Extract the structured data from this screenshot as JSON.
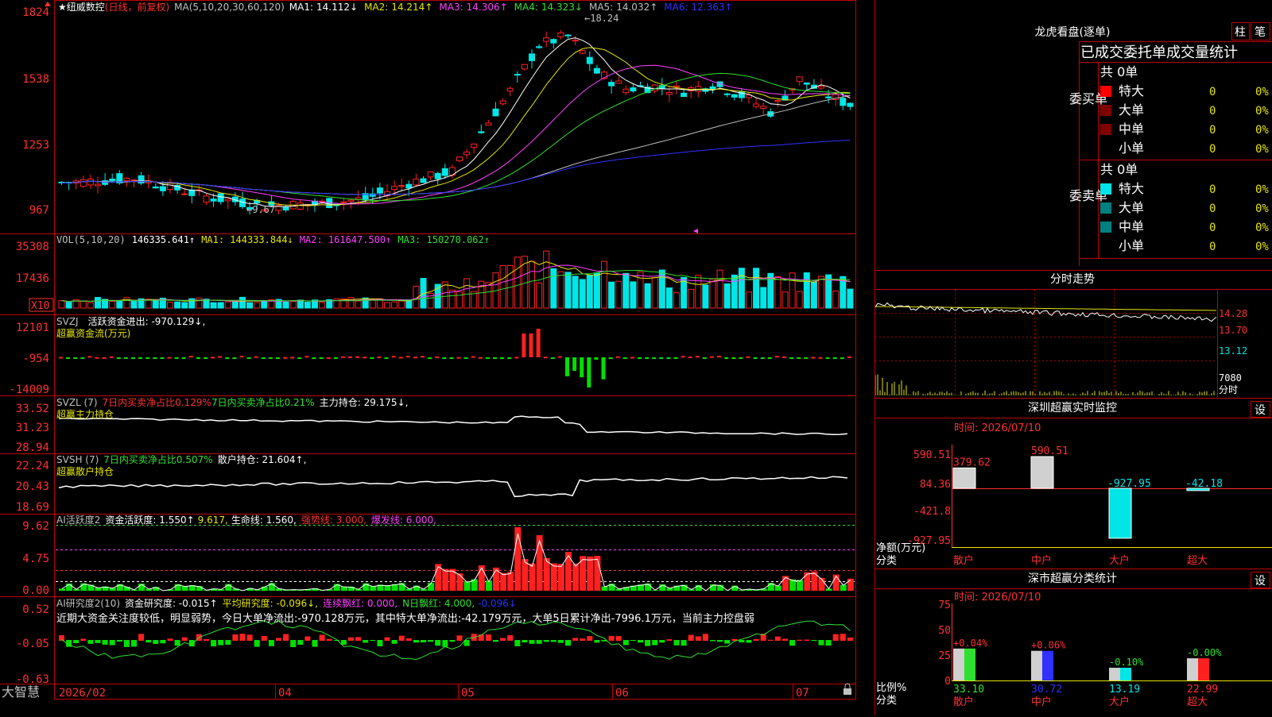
{
  "app": {
    "name": "大智慧"
  },
  "colors": {
    "up": "#ff2020",
    "down": "#00e6e6",
    "grid": "#a00000",
    "axis": "#ff3030",
    "ma1": "#ffffff",
    "ma2": "#e6e600",
    "ma3": "#ff40ff",
    "ma4": "#30e030",
    "ma5": "#c0c0c0",
    "ma6": "#3030ff"
  },
  "price_panel": {
    "star": "★",
    "stock_name": "纽威数控",
    "period": "(日线，前复权)",
    "ma_params": "MA(5,10,20,30,60,120)",
    "ma": [
      {
        "label": "MA1:",
        "value": "14.112↓",
        "color": "#ffffff"
      },
      {
        "label": "MA2:",
        "value": "14.214↑",
        "color": "#e6e600"
      },
      {
        "label": "MA3:",
        "value": "14.306↑",
        "color": "#ff40ff"
      },
      {
        "label": "MA4:",
        "value": "14.323↓",
        "color": "#30e030"
      },
      {
        "label": "MA5:",
        "value": "14.032↑",
        "color": "#c0c0c0"
      },
      {
        "label": "MA6:",
        "value": "12.363↑",
        "color": "#3030ff"
      }
    ],
    "axis": [
      "1824",
      "1538",
      "1253",
      "967"
    ],
    "high_note": "18.24",
    "low_note": "9.67"
  },
  "vol_panel": {
    "label": "VOL(5,10,20)",
    "value": "146335.641↑",
    "ma1": "MA1: 144333.844↓",
    "ma2": "MA2: 161647.500↑",
    "ma3": "MA3: 150270.062↑",
    "axis": [
      "35308",
      "17436"
    ],
    "unit": "X10"
  },
  "svzj_panel": {
    "label": "SVZJ",
    "desc": "活跃资金进出: -970.129↓,",
    "sub": "超赢资金流(万元)",
    "axis": [
      "12101",
      "-954",
      "-14009"
    ]
  },
  "svzl_panel": {
    "label": "SVZL (7)",
    "a": "7日内买卖净占比0.129%",
    "b": "7日内买卖净占比0.21%",
    "c": "主力持仓: 29.175↓,",
    "sub": "超赢主力持仓",
    "axis": [
      "33.52",
      "31.23",
      "28.94"
    ]
  },
  "svsh_panel": {
    "label": "SVSH (7)",
    "a": "7日内买卖净占比0.507%",
    "c": "散户持仓: 21.604↑,",
    "sub": "超赢散户持仓",
    "axis": [
      "22.24",
      "20.43",
      "18.69"
    ]
  },
  "ai_panel": {
    "label": "AI活跃度2",
    "a": "资金活跃度: 1.550↑",
    "b": "9.617,",
    "c": "生命线: 1.560,",
    "d": "强势线: 3.000,",
    "e": "爆发线: 6.000,",
    "axis": [
      "9.62",
      "4.75",
      "0.00"
    ]
  },
  "ai2_panel": {
    "label": "AI研究度2(10)",
    "a": "资金研究度: -0.015↑",
    "b": "平均研究度: -0.096↓,",
    "c": "连续飘红: 0.000,",
    "d": "N日飘红: 4.000,",
    "e": "-0.096↓",
    "summary": "近期大资金关注度较低，明显弱势，今日大单净流出:-970.128万元，其中特大单净流出:-42.179万元，大单5日累计净出-7996.1万元，当前主力控盘弱",
    "axis": [
      "0.52",
      "-0.05",
      "-0.63"
    ]
  },
  "xaxis": [
    "2026/02",
    "04",
    "05",
    "06",
    "07"
  ],
  "dragon": {
    "title": "龙虎看盘(逐单)",
    "btn_bar": "柱",
    "btn_pen": "笔",
    "subtitle": "已成交委托单成交量统计",
    "buy": {
      "side": "委买单",
      "total": "共 0单",
      "rows": [
        {
          "label": "特大",
          "val": "0",
          "pct": "0%"
        },
        {
          "label": "大单",
          "val": "0",
          "pct": "0%"
        },
        {
          "label": "中单",
          "val": "0",
          "pct": "0%"
        },
        {
          "label": "小单",
          "val": "0",
          "pct": "0%"
        }
      ]
    },
    "sell": {
      "side": "委卖单",
      "total": "共 0单",
      "rows": [
        {
          "label": "特大",
          "val": "0",
          "pct": "0%"
        },
        {
          "label": "大单",
          "val": "0",
          "pct": "0%"
        },
        {
          "label": "中单",
          "val": "0",
          "pct": "0%"
        },
        {
          "label": "小单",
          "val": "0",
          "pct": "0%"
        }
      ]
    }
  },
  "intraday": {
    "title": "分时走势",
    "axis": [
      "14.28",
      "13.70",
      "13.12",
      "7080"
    ],
    "unit": "分时"
  },
  "sz_monitor": {
    "title": "深圳超赢实时监控",
    "settings": "设",
    "time": "时间: 2026/07/10",
    "ylabel": "净额(万元)",
    "xlabel": "分类",
    "axis": [
      "590.51",
      "84.36",
      "-421.8",
      "-927.95"
    ],
    "categories": [
      "散户",
      "中户",
      "大户",
      "超大"
    ],
    "values": [
      "379.62",
      "590.51",
      "-927.95",
      "-42.18"
    ]
  },
  "sz_class": {
    "title": "深市超赢分类统计",
    "settings": "设",
    "time": "时间: 2026/07/10",
    "ylabel": "比例%",
    "xlabel": "分类",
    "axis": [
      "75",
      "50",
      "25",
      "0"
    ],
    "categories": [
      "散户",
      "中户",
      "大户",
      "超大"
    ],
    "changes": [
      "+0.04%",
      "+0.06%",
      "-0.10%",
      "-0.00%"
    ],
    "values": [
      "33.10",
      "30.72",
      "13.19",
      "22.99"
    ]
  }
}
